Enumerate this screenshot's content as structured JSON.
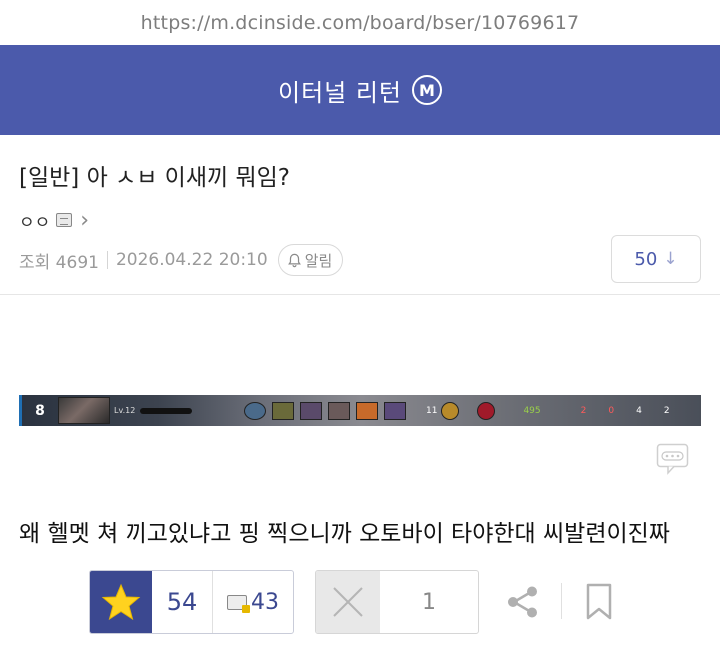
{
  "browser": {
    "url": "https://m.dcinside.com/board/bser/10769617"
  },
  "header": {
    "gallery_name": "이터널 리턴",
    "badge": "M",
    "color": "#4b5aab"
  },
  "post": {
    "title": "[일반] 아 ㅅㅂ 이새끼 뭐임?",
    "author": "ㅇㅇ",
    "views": "조회 4691",
    "date": "2026.04.22 20:10",
    "alarm_label": "알림",
    "comment_count": "50",
    "body_text": "왜 헬멧 쳐 끼고있냐고 핑 찍으니까 오토바이 타야한대 씨발련이진짜"
  },
  "game_hud": {
    "player_level": "8",
    "level_text": "Lv.12",
    "kills_small": "11",
    "stat_main": "495",
    "stats": [
      "2",
      "0",
      "4",
      "2"
    ]
  },
  "actions": {
    "recommend_count": "54",
    "fixed_recommend_count": "43",
    "nonrecommend_count": "1"
  },
  "icons": [
    "bell-icon",
    "star-icon",
    "x-icon",
    "share-icon",
    "bookmark-icon",
    "chat-icon",
    "gallog-icon",
    "chevron-right-icon"
  ]
}
